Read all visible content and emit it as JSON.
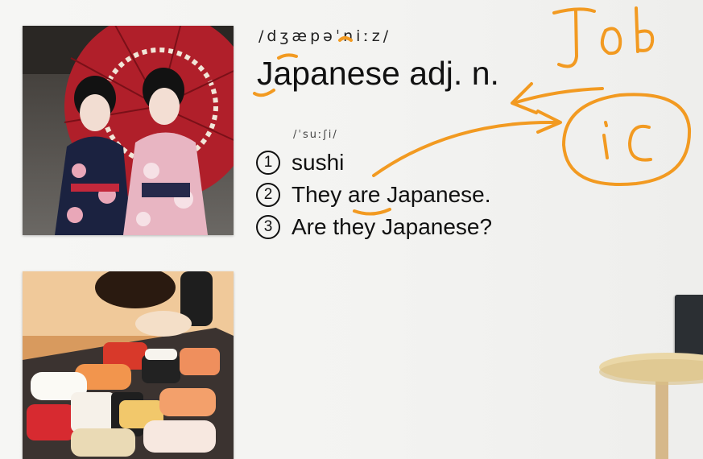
{
  "lesson": {
    "phonetic": "/dʒæpəˈniːz/",
    "word": "Japanese adj. n.",
    "sub_phonetic": "/ˈsuːʃi/",
    "examples": [
      {
        "number": "1",
        "text": "sushi"
      },
      {
        "number": "2",
        "text": "They are Japanese."
      },
      {
        "number": "3",
        "text": "Are they Japanese?"
      }
    ]
  },
  "annotations": {
    "handwritten_word": "Job",
    "handwritten_circle_text": "ic",
    "ink_color": "#f29a21"
  },
  "images": [
    {
      "name": "kimono-photo",
      "subject": "two women in kimono with red umbrella"
    },
    {
      "name": "sushi-photo",
      "subject": "plate of sushi"
    }
  ]
}
